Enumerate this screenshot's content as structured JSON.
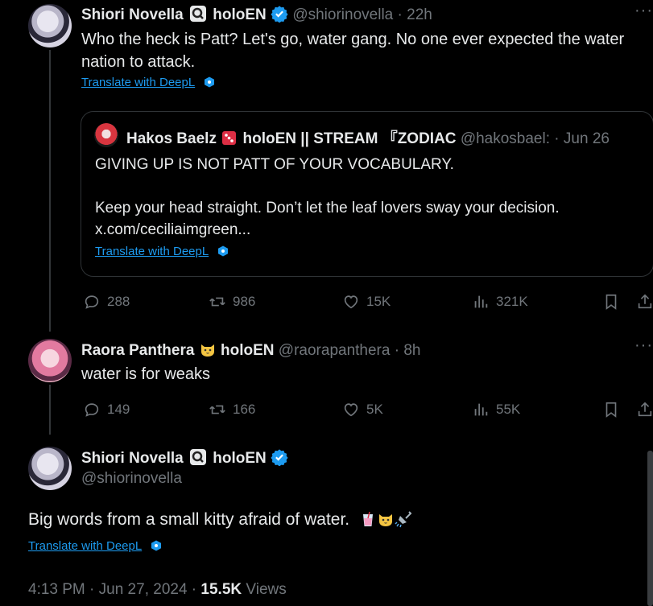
{
  "tweet1": {
    "display_name": "Shiori Novella",
    "affiliation": "holoEN",
    "handle": "@shiorinovella",
    "separator": "·",
    "time": "22h",
    "text_line1": "Who the heck is Patt? Let's go, water gang. No one ever expected the water",
    "text_line2": "nation to attack.",
    "translate": "Translate with DeepL",
    "quote": {
      "display_name": "Hakos Baelz",
      "affiliation": "holoEN || STREAM 『ZODIAC",
      "handle": "@hakosbael:",
      "date": "· Jun 26",
      "line1": "GIVING UP IS NOT PATT OF YOUR VOCABULARY.",
      "line2": "Keep your head straight. Don’t let the leaf lovers sway your decision.",
      "line3": "x.com/ceciliaimgreen...",
      "translate": "Translate with DeepL"
    },
    "actions": {
      "replies": "288",
      "reposts": "986",
      "likes": "15K",
      "views": "321K"
    }
  },
  "tweet2": {
    "display_name": "Raora Panthera",
    "affiliation": "holoEN",
    "handle": "@raorapanthera",
    "separator": "·",
    "time": "8h",
    "text": "water is for weaks",
    "actions": {
      "replies": "149",
      "reposts": "166",
      "likes": "5K",
      "views": "55K"
    }
  },
  "main_tweet": {
    "display_name": "Shiori Novella",
    "affiliation": "holoEN",
    "handle": "@shiorinovella",
    "text": "Big words from a small kitty afraid of water.",
    "translate": "Translate with DeepL",
    "timestamp": "4:13 PM · Jun 27, 2024 ·",
    "views_count": "15.5K",
    "views_label": "Views"
  },
  "more_label": "···",
  "colors": {
    "background": "#000000",
    "text": "#e7e9ea",
    "muted": "#71767b",
    "link": "#1d9bf0",
    "verified": "#1d9bf0"
  }
}
